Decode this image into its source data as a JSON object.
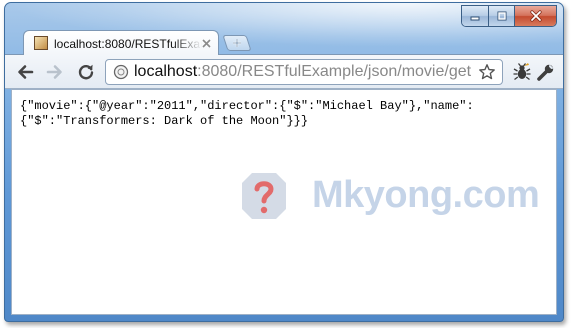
{
  "tab": {
    "title": "localhost:8080/RESTfulExample/json/movie/get"
  },
  "address_bar": {
    "host": "localhost",
    "path": ":8080/RESTfulExample/json/movie/get"
  },
  "page": {
    "json_line_1": "{\"movie\":{\"@year\":\"2011\",\"director\":{\"$\":\"Michael Bay\"},\"name\":",
    "json_line_2": "{\"$\":\"Transformers: Dark of the Moon\"}}}"
  },
  "watermark": {
    "text": "Mkyong.com"
  },
  "icons": {
    "minimize": "minimize-icon",
    "maximize": "maximize-icon",
    "close": "close-icon",
    "back": "back-arrow-icon",
    "forward": "forward-arrow-icon",
    "reload": "reload-icon",
    "page": "page-globe-icon",
    "bookmark": "star-icon",
    "extension": "bug-extension-icon",
    "settings": "wrench-icon"
  },
  "colors": {
    "frame": "#5f98d6",
    "close_button": "#c44a2f",
    "url_path": "#888888",
    "watermark": "#c5d4e8"
  }
}
